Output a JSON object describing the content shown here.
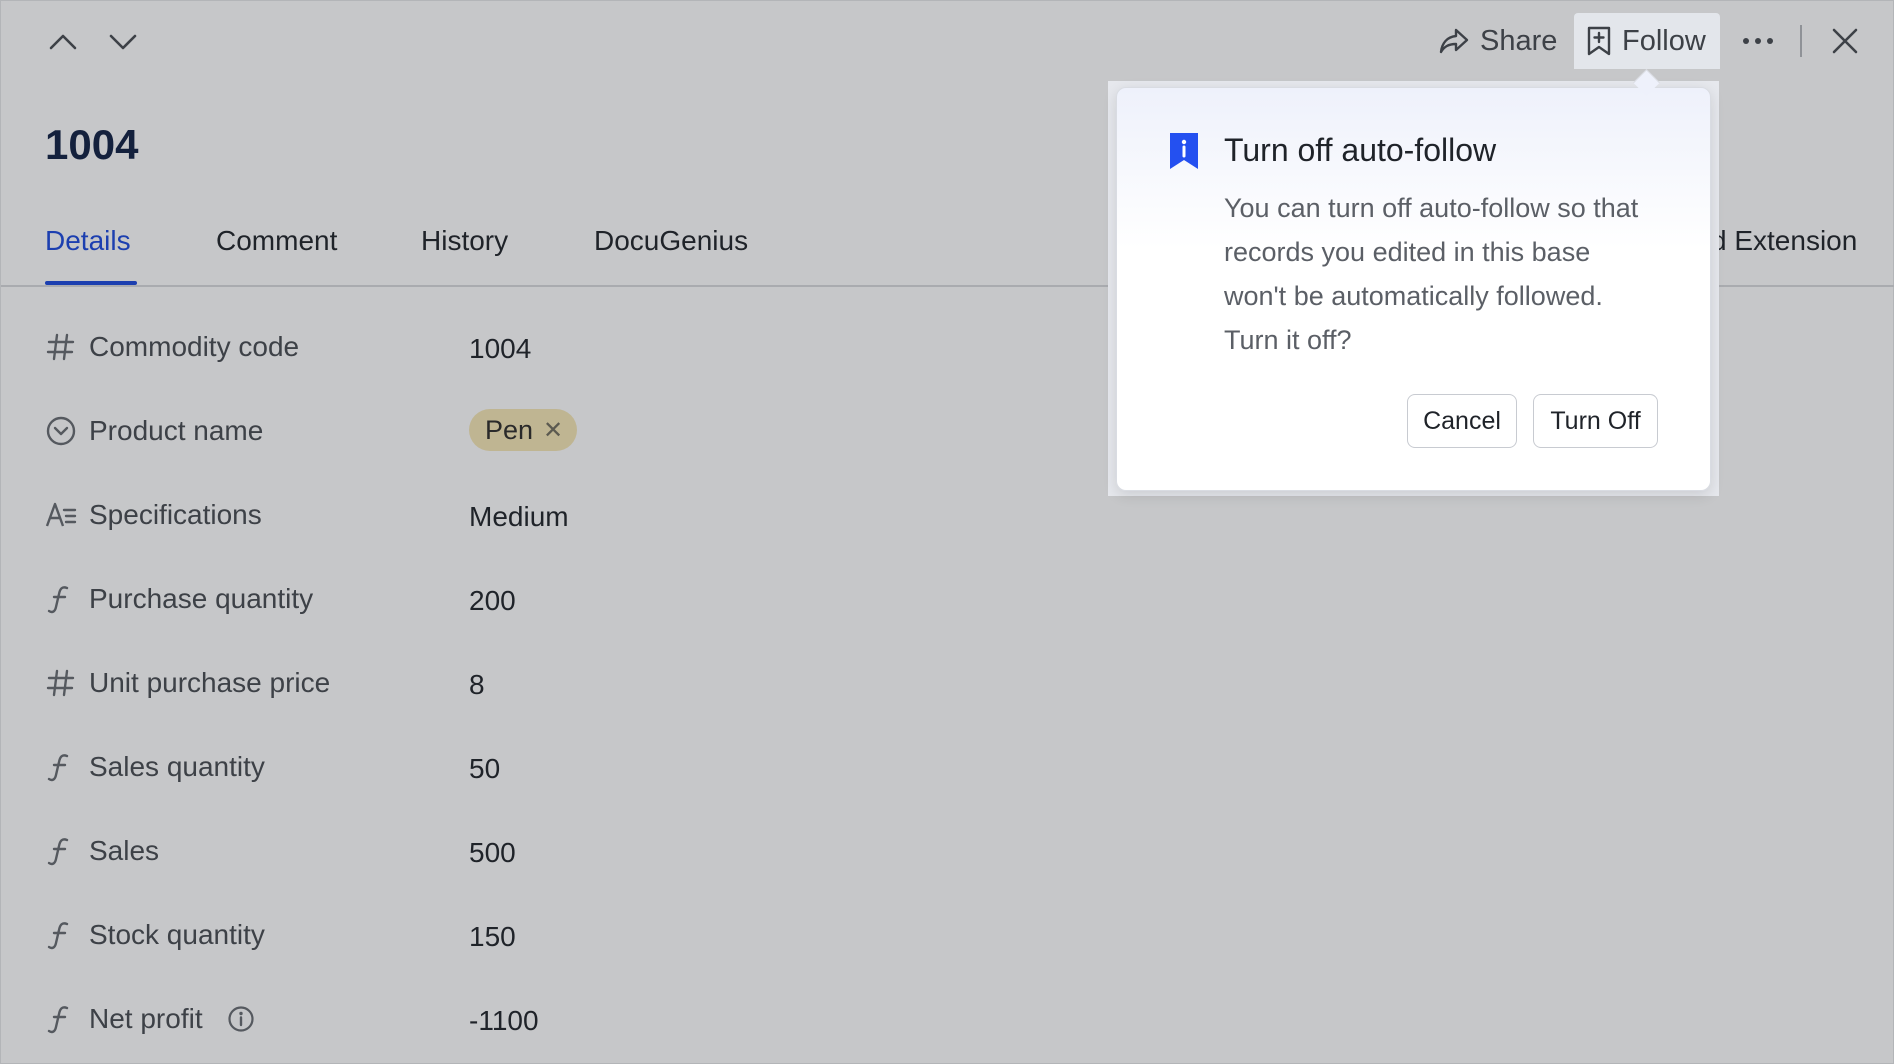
{
  "toolbar": {
    "prev_icon": "chevron-up-icon",
    "next_icon": "chevron-down-icon",
    "share_label": "Share",
    "follow_label": "Follow",
    "more_icon": "more-horizontal-icon",
    "close_icon": "close-icon"
  },
  "record": {
    "title": "1004"
  },
  "tabs": [
    {
      "label": "Details",
      "active": true
    },
    {
      "label": "Comment"
    },
    {
      "label": "History"
    },
    {
      "label": "DocuGenius"
    },
    {
      "label": "d Extension"
    }
  ],
  "fields": [
    {
      "icon": "number-icon",
      "label": "Commodity code",
      "value": "1004"
    },
    {
      "icon": "single-select-icon",
      "label": "Product name",
      "value": "Pen"
    },
    {
      "icon": "text-icon",
      "label": "Specifications",
      "value": "Medium"
    },
    {
      "icon": "formula-icon",
      "label": "Purchase quantity",
      "value": "200"
    },
    {
      "icon": "number-icon",
      "label": "Unit purchase price",
      "value": "8"
    },
    {
      "icon": "formula-icon",
      "label": "Sales quantity",
      "value": "50"
    },
    {
      "icon": "formula-icon",
      "label": "Sales",
      "value": "500"
    },
    {
      "icon": "formula-icon",
      "label": "Stock quantity",
      "value": "150"
    },
    {
      "icon": "formula-icon",
      "label": "Net profit",
      "value": "-1100",
      "info_icon": "info-icon"
    }
  ],
  "popover": {
    "icon": "info-bookmark-icon",
    "title": "Turn off auto-follow",
    "body": "You can turn off auto-follow so that records you edited in this base won't be automatically followed. Turn it off?",
    "cancel_label": "Cancel",
    "confirm_label": "Turn Off"
  },
  "colors": {
    "accent": "#1c3fb0",
    "overlay_bg": "#c6c7c9",
    "chip_bg": "#bfb592",
    "popover_icon": "#2450f0"
  }
}
